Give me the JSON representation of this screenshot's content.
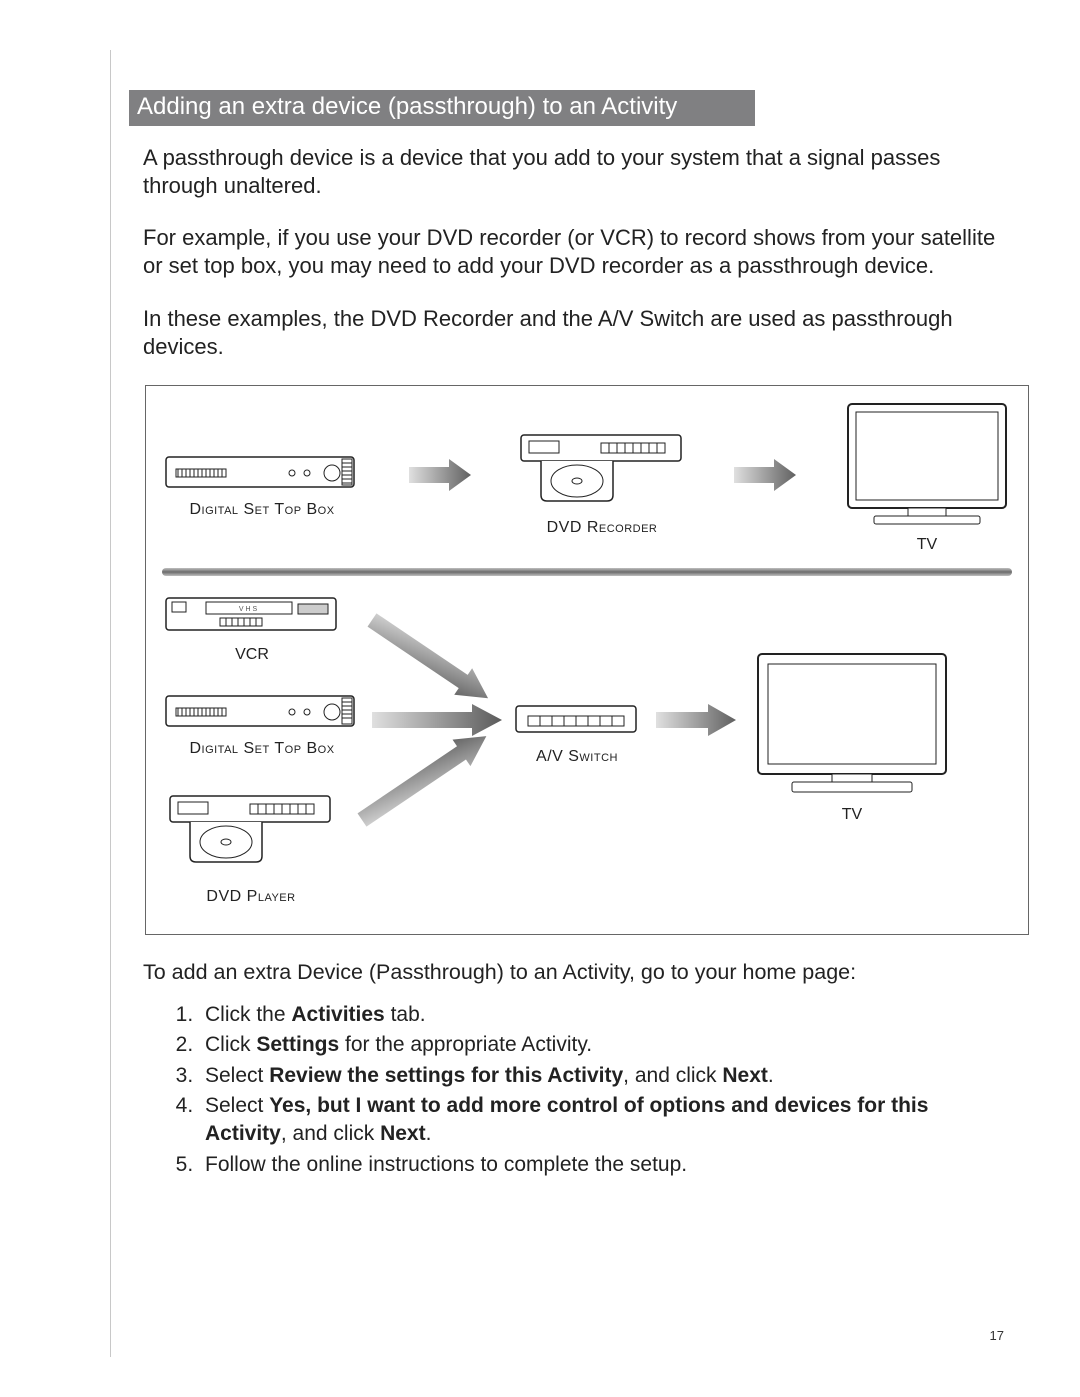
{
  "heading": "Adding an extra device (passthrough) to an Activity",
  "para1": "A passthrough device is a device that you add to your system that a signal passes through unaltered.",
  "para2": "For example,  if you use your DVD recorder (or VCR) to record shows from your satellite or set top box, you may need to add your DVD recorder as a passthrough device.",
  "para3": "In these examples, the DVD Recorder and the A/V Switch are used as passthrough devices.",
  "diagram": {
    "top": {
      "left": "Digital Set Top Box",
      "mid": "DVD Recorder",
      "right": "TV"
    },
    "bottom": {
      "vcr": "VCR",
      "stb": "Digital Set Top Box",
      "dvd": "DVD Player",
      "switch": "A/V Switch",
      "tv": "TV"
    }
  },
  "instr_lead": "To add an extra Device (Passthrough) to an Activity, go to your home page:",
  "steps": {
    "s1a": "Click the ",
    "s1b": "Activities",
    "s1c": " tab.",
    "s2a": "Click ",
    "s2b": "Settings",
    "s2c": " for the appropriate Activity.",
    "s3a": "Select ",
    "s3b": "Review the settings for this Activity",
    "s3c": ", and click ",
    "s3d": "Next",
    "s3e": ".",
    "s4a": "Select ",
    "s4b": "Yes, but I want to add more control of options and devices for this Activity",
    "s4c": ", and click ",
    "s4d": "Next",
    "s4e": ".",
    "s5": "Follow the online instructions to complete the setup."
  },
  "page_number": "17"
}
